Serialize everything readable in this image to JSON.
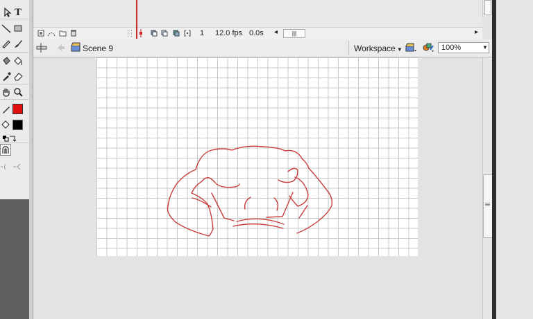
{
  "timeline": {
    "frame": "1",
    "fps": "12.0 fps",
    "time": "0.0s",
    "scroll_left": "◂",
    "scroll_grip": "|||",
    "scroll_right": "▸"
  },
  "edit_bar": {
    "scene_label": "Scene 9",
    "workspace_label": "Workspace",
    "zoom_value": "100%"
  },
  "tools": {
    "text_tool_glyph": "T",
    "stroke_color": "#e01010",
    "fill_color": "#000000"
  },
  "colors": {
    "drawing": "#c83c3c",
    "grid": "#c9c9c9"
  },
  "icons": [
    "subselect-icon",
    "text-tool-icon",
    "line-tool-icon",
    "rectangle-tool-icon",
    "pencil-tool-icon",
    "brush-tool-icon",
    "ink-bottle-icon",
    "paint-bucket-icon",
    "eyedropper-icon",
    "eraser-icon",
    "hand-tool-icon",
    "zoom-tool-icon",
    "stroke-color-icon",
    "fill-color-icon",
    "swap-colors-icon",
    "snap-magnet-icon",
    "smooth-icon",
    "straighten-icon",
    "scene-icon",
    "edit-symbols-icon",
    "edit-scene-icon",
    "dropdown-icon"
  ]
}
